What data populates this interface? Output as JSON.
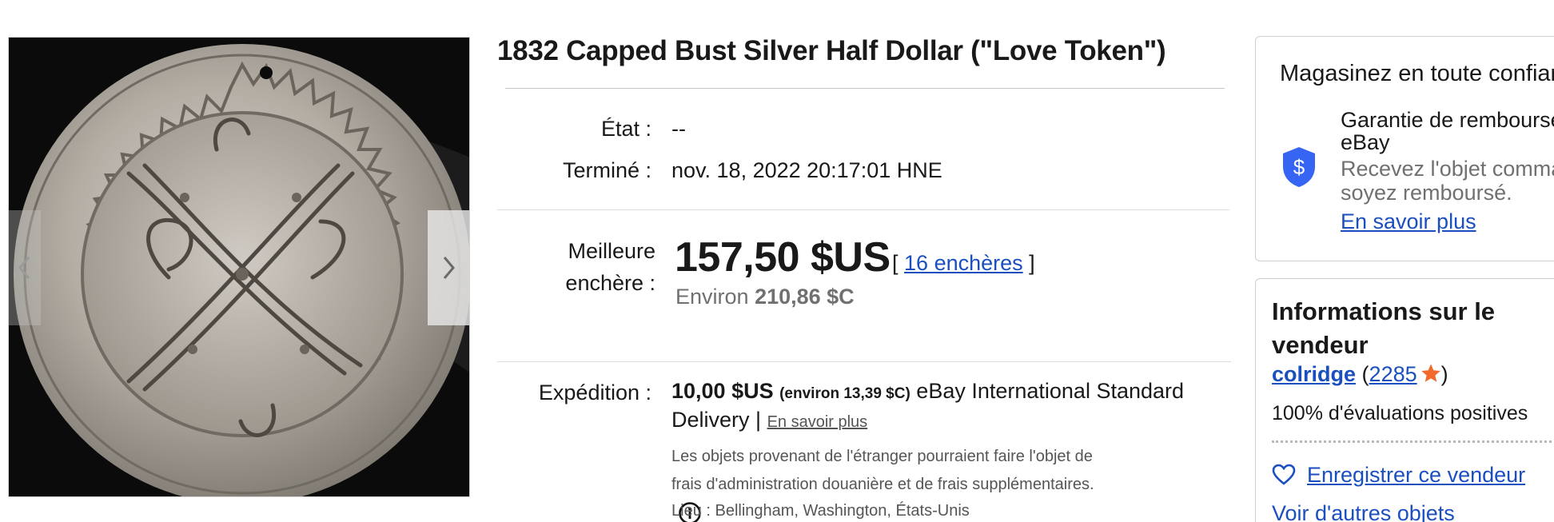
{
  "item": {
    "title": "1832 Capped Bust Silver Half Dollar (\"Love Token\")",
    "condition_label": "État :",
    "condition_value": "--",
    "ended_label": "Terminé :",
    "ended_value": "nov. 18, 2022 20:17:01 HNE"
  },
  "bid": {
    "label_line1": "Meilleure",
    "label_line2": "enchère :",
    "price": "157,50 $US",
    "bids_open": "[",
    "bids_link": "16 enchères",
    "bids_close": "]",
    "approx_prefix": "Environ",
    "approx_value": "210,86 $C"
  },
  "shipping": {
    "label": "Expédition :",
    "cost": "10,00 $US",
    "cost_approx": "(environ 13,39 $C)",
    "service_part1": "eBay International Standard",
    "service_part2": "Delivery |",
    "learn_more": "En savoir plus",
    "customs_note": "Les objets provenant de l'étranger pourraient faire l'objet de frais d'administration douanière et de frais supplémentaires.",
    "location": "Lieu : Bellingham, Washington, États-Unis"
  },
  "trust": {
    "title": "Magasinez en toute confiance",
    "guarantee_title": "Garantie de remboursement eBay",
    "guarantee_desc": "Recevez l'objet commandé ou soyez remboursé.",
    "learn_more": "En savoir plus",
    "shield_color": "#3665f3"
  },
  "seller": {
    "section_title": "Informations sur le vendeur",
    "name": "colridge",
    "open_paren": "(",
    "score": "2285",
    "close_paren": ")",
    "star_color": "#f16a2c",
    "feedback": "100% d'évaluations positives",
    "save_seller": "Enregistrer ce vendeur",
    "other_items": "Voir d'autres objets"
  },
  "icons": {
    "prev": "chevron-left-icon",
    "next": "chevron-right-icon",
    "info": "info-icon",
    "shield": "shield-dollar-icon",
    "star": "star-icon",
    "heart": "heart-icon"
  }
}
